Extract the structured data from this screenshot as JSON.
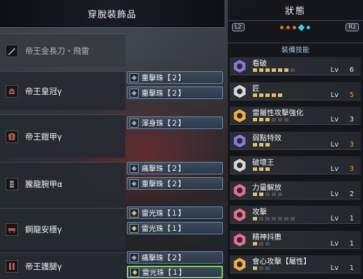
{
  "left_panel": {
    "title": "穿脫裝飾品",
    "equipment": [
      {
        "name": "帝王金長刀・飛雷",
        "icon": "weapon-icon",
        "dim": true
      },
      {
        "name": "帝王皇冠γ",
        "icon": "helm-icon"
      },
      {
        "name": "帝王鎧甲γ",
        "icon": "chest-icon"
      },
      {
        "name": "騰龍腕甲α",
        "icon": "arms-icon"
      },
      {
        "name": "鋼龍安穩γ",
        "icon": "waist-icon"
      },
      {
        "name": "帝王護腿γ",
        "icon": "legs-icon"
      }
    ],
    "decorations": [
      {
        "label": "重擊珠【２】",
        "icon": "jewel-icon"
      },
      {
        "label": "重擊珠【２】",
        "icon": "jewel-icon"
      },
      {
        "label": "渾身珠【２】",
        "icon": "jewel-icon"
      },
      {
        "label": "痛擊珠【２】",
        "icon": "jewel-icon"
      },
      {
        "label": "重擊珠【２】",
        "icon": "jewel-icon"
      },
      {
        "label": "雷光珠【１】",
        "icon": "jewel-icon"
      },
      {
        "label": "雷光珠【１】",
        "icon": "jewel-icon"
      },
      {
        "label": "痛擊珠【２】",
        "icon": "jewel-icon"
      },
      {
        "label": "雷光珠【１】",
        "icon": "jewel-icon",
        "selected": true
      }
    ]
  },
  "right_panel": {
    "title": "狀態",
    "left_trigger": "L2",
    "right_trigger": "R2",
    "section": "裝備技能",
    "skills": [
      {
        "name": "看破",
        "lv_label": "Lv",
        "lv": "6",
        "max": 7,
        "color": "#8a78d8",
        "highlight": false
      },
      {
        "name": "匠",
        "lv_label": "Lv",
        "lv": "5",
        "max": 5,
        "color": "#d8d8d8",
        "highlight": true
      },
      {
        "name": "雷屬性攻擊強化",
        "lv_label": "Lv",
        "lv": "3",
        "max": 6,
        "color": "#e8b04a",
        "highlight": false
      },
      {
        "name": "弱點特效",
        "lv_label": "Lv",
        "lv": "3",
        "max": 3,
        "color": "#8a78d8",
        "highlight": true
      },
      {
        "name": "破壞王",
        "lv_label": "Lv",
        "lv": "3",
        "max": 3,
        "color": "#d8d8d8",
        "highlight": true
      },
      {
        "name": "力量解放",
        "lv_label": "Lv",
        "lv": "2",
        "max": 5,
        "color": "#e07090",
        "highlight": false
      },
      {
        "name": "攻擊",
        "lv_label": "Lv",
        "lv": "1",
        "max": 7,
        "color": "#e07090",
        "highlight": false
      },
      {
        "name": "精神抖擻",
        "lv_label": "Lv",
        "lv": "1",
        "max": 3,
        "color": "#e07090",
        "highlight": false
      },
      {
        "name": "會心攻擊【屬性】",
        "lv_label": "Lv",
        "lv": "1",
        "max": 3,
        "color": "#e8b04a",
        "highlight": false
      }
    ]
  }
}
